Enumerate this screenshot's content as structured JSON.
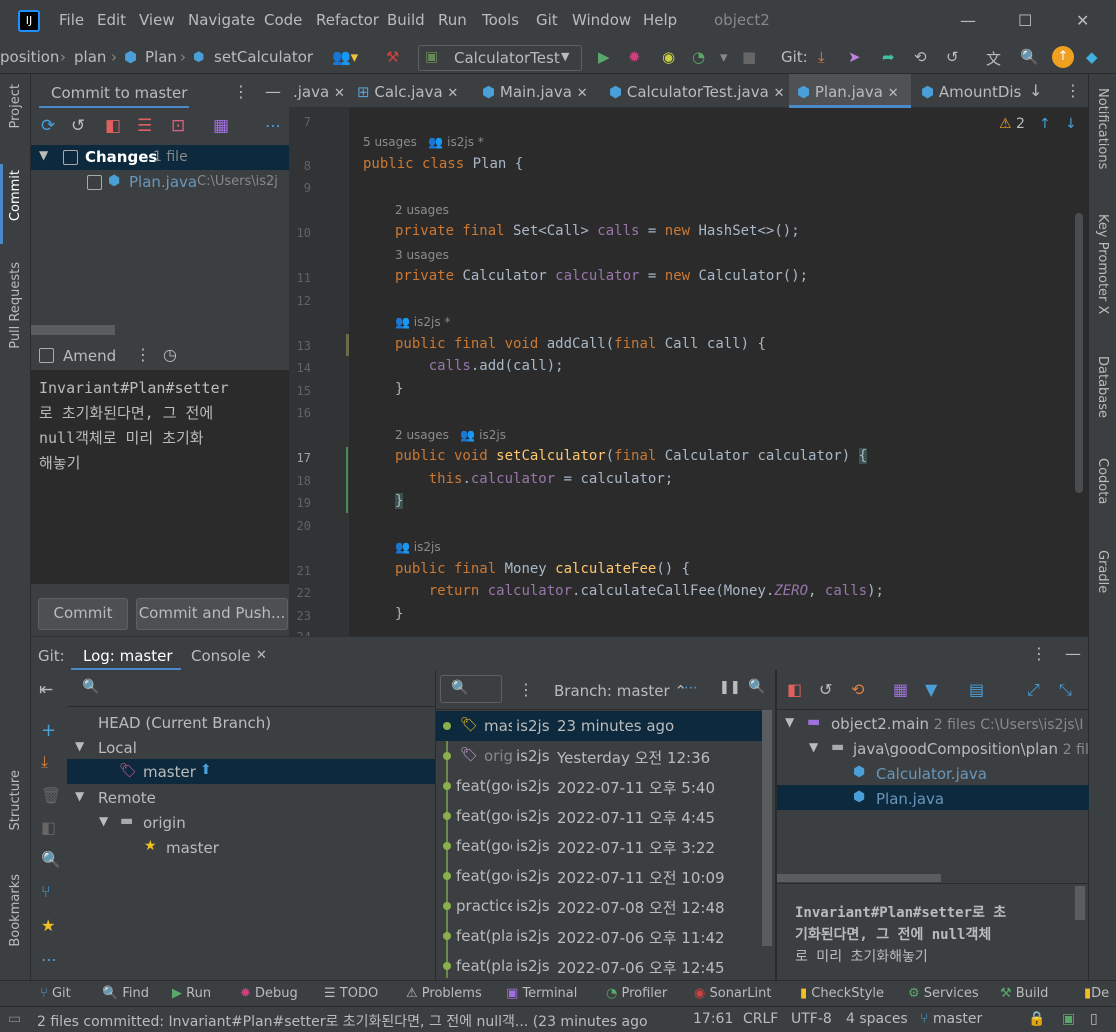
{
  "titlebar": {
    "menus": [
      "File",
      "Edit",
      "View",
      "Navigate",
      "Code",
      "Refactor",
      "Build",
      "Run",
      "Tools",
      "Git",
      "Window",
      "Help"
    ],
    "project": "object2"
  },
  "navbar": {
    "crumbs": [
      "position",
      "plan",
      "Plan",
      "setCalculator"
    ],
    "run_config": "CalculatorTest",
    "git_label": "Git:"
  },
  "left_stripe": {
    "project": "Project",
    "commit": "Commit",
    "pull_requests": "Pull Requests",
    "structure": "Structure",
    "bookmarks": "Bookmarks"
  },
  "right_stripe": {
    "notifications": "Notifications",
    "key_promoter": "Key Promoter X",
    "database": "Database",
    "codota": "Codota",
    "gradle": "Gradle"
  },
  "commit_panel": {
    "title": "Commit to master",
    "changes_label": "Changes",
    "changes_count": "1 file",
    "file_name": "Plan.java",
    "file_path": "C:\\Users\\is2j",
    "amend_label": "Amend",
    "message_lines": [
      "Invariant#Plan#setter",
      "로 초기화된다면, 그 전에",
      "null객체로 미리 초기화",
      "해놓기"
    ],
    "commit_button": "Commit",
    "commit_push_button": "Commit and Push..."
  },
  "editor": {
    "tabs": [
      ".java",
      "Calc.java",
      "Main.java",
      "CalculatorTest.java",
      "Plan.java",
      "AmountDis"
    ],
    "warnings": "2",
    "line_numbers": [
      "7",
      "8",
      "9",
      "10",
      "11",
      "12",
      "13",
      "14",
      "15",
      "16",
      "17",
      "18",
      "19",
      "20",
      "21",
      "22",
      "23",
      "24"
    ],
    "hints": {
      "class": "5 usages",
      "class_author": "is2js *",
      "calls": "2 usages",
      "calculator": "3 usages",
      "addcall_author": "is2js *",
      "setcalc": "2 usages",
      "setcalc_author": "is2js",
      "calcfee_author": "is2js"
    }
  },
  "bottom": {
    "git_label": "Git:",
    "log_tab": "Log: master",
    "console_tab": "Console",
    "search_placeholder": "",
    "branch_filter": "Branch: master",
    "branches": {
      "head": "HEAD (Current Branch)",
      "local": "Local",
      "local_master": "master",
      "remote": "Remote",
      "origin": "origin",
      "remote_master": "master"
    },
    "commits": [
      {
        "msg": "mast",
        "author": "is2js",
        "date": "23 minutes ago"
      },
      {
        "msg": "origin",
        "author": "is2js",
        "date": "Yesterday 오전 12:36"
      },
      {
        "msg": "feat(goc",
        "author": "is2js",
        "date": "2022-07-11 오후 5:40"
      },
      {
        "msg": "feat(goc",
        "author": "is2js",
        "date": "2022-07-11 오후 4:45"
      },
      {
        "msg": "feat(goc",
        "author": "is2js",
        "date": "2022-07-11 오후 3:22"
      },
      {
        "msg": "feat(goc",
        "author": "is2js",
        "date": "2022-07-11 오전 10:09"
      },
      {
        "msg": "practice(",
        "author": "is2js",
        "date": "2022-07-08 오전 12:48"
      },
      {
        "msg": "feat(plar",
        "author": "is2js",
        "date": "2022-07-06 오후 11:42"
      },
      {
        "msg": "feat(plar",
        "author": "is2js",
        "date": "2022-07-06 오후 12:45"
      }
    ],
    "tree": {
      "root": "object2.main",
      "root_info": "2 files  C:\\Users\\is2js\\I",
      "package": "java\\goodComposition\\plan",
      "package_info": "2 fil",
      "file1": "Calculator.java",
      "file2": "Plan.java"
    },
    "detail_message": [
      "Invariant#Plan#setter로 초",
      "기화된다면, 그 전에 null객체",
      "로 미리 초기화해놓기"
    ]
  },
  "toolstrip": [
    "Git",
    "Find",
    "Run",
    "Debug",
    "TODO",
    "Problems",
    "Terminal",
    "Profiler",
    "SonarLint",
    "CheckStyle",
    "Services",
    "Build",
    "De"
  ],
  "status": {
    "message": "2 files committed: Invariant#Plan#setter로 초기화된다면, 그 전에 null객... (23 minutes ago)",
    "position": "17:61",
    "line_sep": "CRLF",
    "encoding": "UTF-8",
    "indent": "4 spaces",
    "branch": "master"
  },
  "colors": {
    "accent": "#4a88c7",
    "keyword": "#cc7832",
    "field": "#9876aa",
    "method": "#ffc66d",
    "selection": "#0d293e"
  }
}
